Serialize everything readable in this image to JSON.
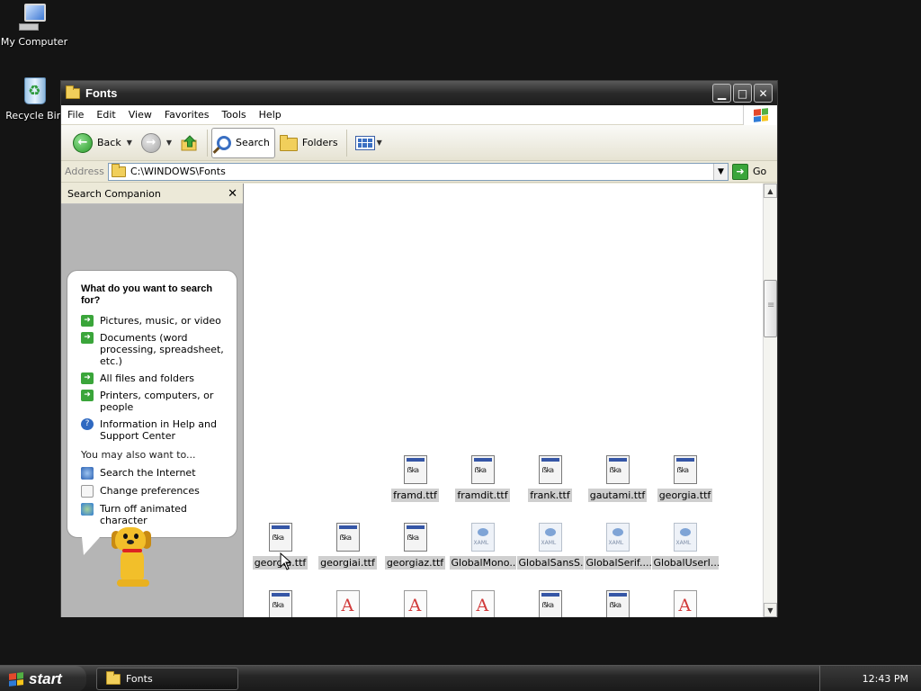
{
  "desktop": {
    "icons": [
      {
        "label": "My Computer"
      },
      {
        "label": "Recycle Bin"
      }
    ]
  },
  "window": {
    "title": "Fonts",
    "controls": {
      "minimize": "▁",
      "maximize": "□",
      "close": "✕"
    }
  },
  "menu": [
    "File",
    "Edit",
    "View",
    "Favorites",
    "Tools",
    "Help"
  ],
  "toolbar": {
    "back_label": "Back",
    "search_label": "Search",
    "folders_label": "Folders"
  },
  "address": {
    "label": "Address",
    "path": "C:\\WINDOWS\\Fonts",
    "go_label": "Go"
  },
  "search_companion": {
    "title": "Search Companion",
    "question": "What do you want to search for?",
    "options": [
      "Pictures, music, or video",
      "Documents (word processing, spreadsheet, etc.)",
      "All files and folders",
      "Printers, computers, or people",
      "Information in Help and Support Center"
    ],
    "also_heading": "You may also want to...",
    "also_options": [
      "Search the Internet",
      "Change preferences",
      "Turn off animated character"
    ]
  },
  "files": {
    "row1": [
      "framd.ttf",
      "framdit.ttf",
      "frank.ttf",
      "gautami.ttf",
      "georgia.ttf"
    ],
    "row2": [
      "georgia.ttf",
      "georgiai.ttf",
      "georgiaz.ttf",
      "GlobalMono....",
      "GlobalSansS...",
      "GlobalSerif....",
      "GlobalUserI..."
    ],
    "row3_types": [
      "ttf",
      "a",
      "a",
      "a",
      "ttf",
      "ttf",
      "a"
    ]
  },
  "taskbar": {
    "start_label": "start",
    "task_label": "Fonts",
    "clock": "12:43 PM"
  },
  "colors": {
    "accent_green": "#3aa53a",
    "selection_gray": "#cfcfcf"
  }
}
